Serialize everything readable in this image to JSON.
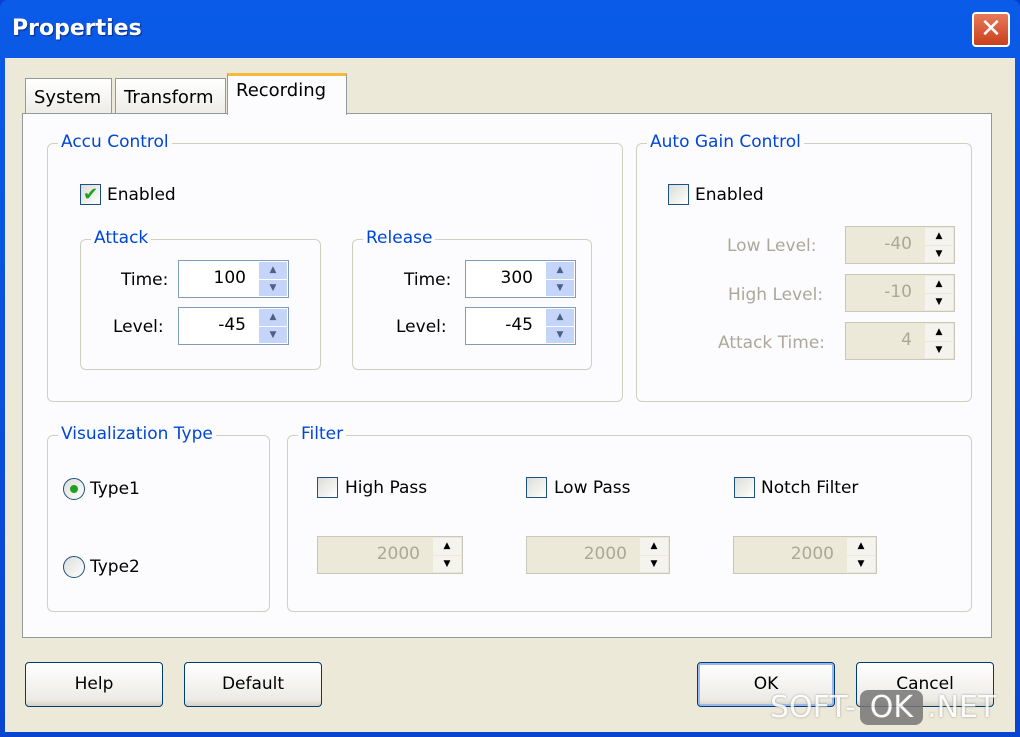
{
  "window": {
    "title": "Properties",
    "close_icon": "close-x-icon"
  },
  "tabs": [
    {
      "label": "System"
    },
    {
      "label": "Transform"
    },
    {
      "label": "Recording",
      "active": true
    }
  ],
  "accu": {
    "title": "Accu Control",
    "enabled_label": "Enabled",
    "enabled": true,
    "attack": {
      "title": "Attack",
      "time_label": "Time:",
      "time": "100",
      "level_label": "Level:",
      "level": "-45"
    },
    "release": {
      "title": "Release",
      "time_label": "Time:",
      "time": "300",
      "level_label": "Level:",
      "level": "-45"
    }
  },
  "agc": {
    "title": "Auto Gain Control",
    "enabled_label": "Enabled",
    "enabled": false,
    "low_label": "Low Level:",
    "low": "-40",
    "high_label": "High Level:",
    "high": "-10",
    "attack_label": "Attack Time:",
    "attack": "4"
  },
  "viz": {
    "title": "Visualization Type",
    "type1": "Type1",
    "type2": "Type2",
    "selected": "Type1"
  },
  "filter": {
    "title": "Filter",
    "high_label": "High Pass",
    "high": "2000",
    "low_label": "Low Pass",
    "low": "2000",
    "notch_label": "Notch Filter",
    "notch": "2000"
  },
  "buttons": {
    "help": "Help",
    "default": "Default",
    "ok": "OK",
    "cancel": "Cancel"
  },
  "watermark": {
    "a": "SOFT-",
    "b": "OK",
    ".c": "",
    "c": ".NET"
  }
}
